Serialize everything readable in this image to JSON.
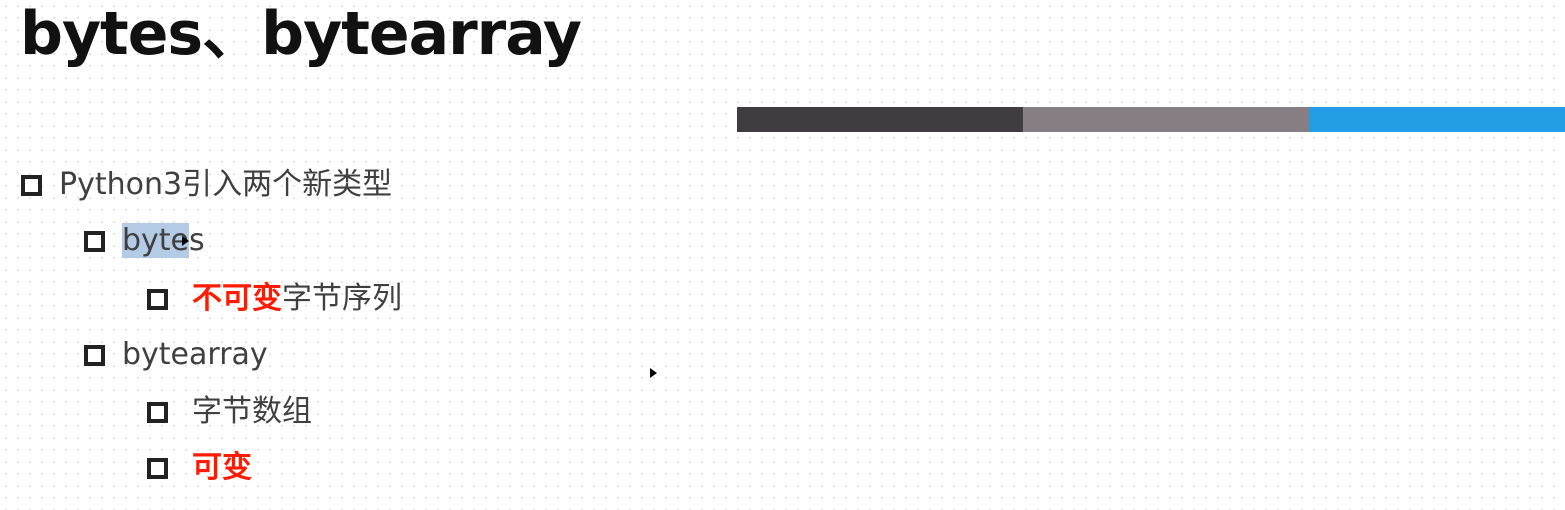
{
  "slide": {
    "title": "bytes、bytearray",
    "accent_colors": [
      "#403d40",
      "#887f84",
      "#229de6"
    ],
    "highlight_color": "#ff1a00",
    "items": [
      {
        "text": "Python3引入两个新类型"
      },
      {
        "text_selected": "byte",
        "text_rest": "s"
      },
      {
        "emphasis": "不可变",
        "rest": "字节序列"
      },
      {
        "text": "bytearray"
      },
      {
        "text": "字节数组"
      },
      {
        "emphasis": "可变"
      }
    ]
  }
}
